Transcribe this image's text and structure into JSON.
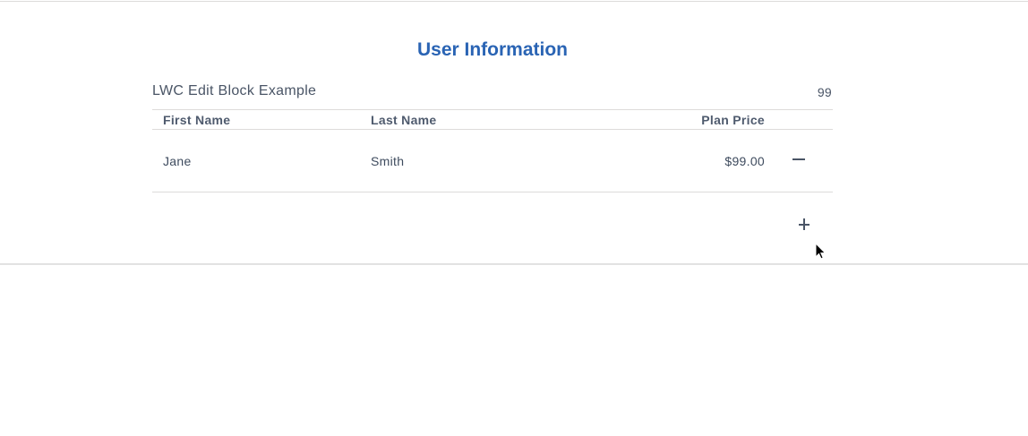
{
  "page": {
    "title": "User Information"
  },
  "block": {
    "name": "LWC Edit Block Example",
    "count": "99"
  },
  "table": {
    "headers": {
      "first_name": "First Name",
      "last_name": "Last Name",
      "plan_price": "Plan Price"
    },
    "rows": [
      {
        "first_name": "Jane",
        "last_name": "Smith",
        "plan_price": "$99.00"
      }
    ]
  },
  "icons": {
    "remove": "minus-icon",
    "add": "plus-icon",
    "cursor": "mouse-pointer-icon"
  },
  "colors": {
    "title": "#2a64b4",
    "text": "#3e4b5e",
    "divider": "#dddbda"
  }
}
